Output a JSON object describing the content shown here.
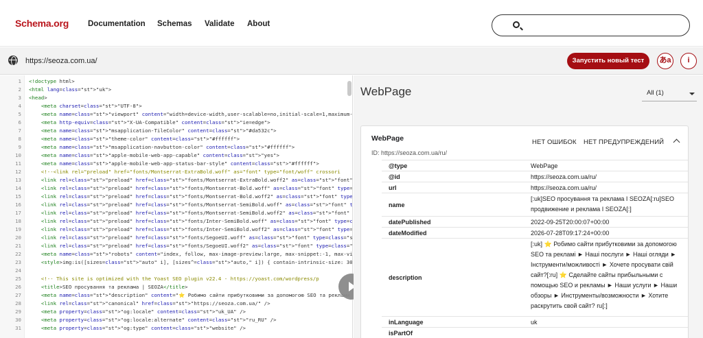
{
  "nav": {
    "logo": "Schema.org",
    "links": [
      "Documentation",
      "Schemas",
      "Validate",
      "About"
    ]
  },
  "urlbar": {
    "url": "https://seoza.com.ua/",
    "run_label": "Запустить новый тест",
    "lang_label": "あa",
    "info_label": "i"
  },
  "code_lines": [
    {
      "n": "1",
      "t": "<!doctype html>"
    },
    {
      "n": "2",
      "t": "<html lang=\"uk\">"
    },
    {
      "n": "3",
      "t": "<head>"
    },
    {
      "n": "4",
      "t": "    <meta charset=\"UTF-8\">"
    },
    {
      "n": "5",
      "t": "    <meta name=\"viewport\" content=\"width=device-width,user-scalable=no,initial-scale=1,maximum-scal"
    },
    {
      "n": "6",
      "t": "    <meta http-equiv=\"X-UA-Compatible\" content=\"ie=edge\">"
    },
    {
      "n": "7",
      "t": "    <meta name=\"msapplication-TileColor\" content=\"#da532c\">"
    },
    {
      "n": "8",
      "t": "    <meta name=\"theme-color\" content=\"#ffffff\">"
    },
    {
      "n": "9",
      "t": "    <meta name=\"msapplication-navbutton-color\" content=\"#ffffff\">"
    },
    {
      "n": "10",
      "t": "    <meta name=\"apple-mobile-web-app-capable\" content=\"yes\">"
    },
    {
      "n": "11",
      "t": "    <meta name=\"apple-mobile-web-app-status-bar-style\" content=\"#ffffff\">"
    },
    {
      "n": "12",
      "t": "    <!--<link rel=\"preload\" href=\"fonts/Montserrat-ExtraBold.woff\" as=\"font\" type=\"font/woff\" crossori"
    },
    {
      "n": "13",
      "t": "    <link rel=\"preload\" href=\"fonts/Montserrat-ExtraBold.woff2\" as=\"font\" type=\"font/woff2\" crossorigi"
    },
    {
      "n": "14",
      "t": "    <link rel=\"preload\" href=\"fonts/Montserrat-Bold.woff\" as=\"font\" type=\"font/woff\" crossorigin=\"a"
    },
    {
      "n": "15",
      "t": "    <link rel=\"preload\" href=\"fonts/Montserrat-Bold.woff2\" as=\"font\" type=\"font/woff2\" crossorigin=\""
    },
    {
      "n": "16",
      "t": "    <link rel=\"preload\" href=\"fonts/Montserrat-SemiBold.woff\" as=\"font\" type=\"font/woff\" crossorigin"
    },
    {
      "n": "17",
      "t": "    <link rel=\"preload\" href=\"fonts/Montserrat-SemiBold.woff2\" as=\"font\" type=\"font/woff2\" crossori"
    },
    {
      "n": "18",
      "t": "    <link rel=\"preload\" href=\"fonts/Inter-SemiBold.woff\" as=\"font\" type=\"font/woff\" crossorigin=\"an"
    },
    {
      "n": "19",
      "t": "    <link rel=\"preload\" href=\"fonts/Inter-SemiBold.woff2\" as=\"font\" type=\"font/woff2\" crossorigin=\""
    },
    {
      "n": "20",
      "t": "    <link rel=\"preload\" href=\"fonts/SegoeUI.woff\" as=\"font\" type=\"font/woff\" crossorigin=\"anonymous"
    },
    {
      "n": "21",
      "t": "    <link rel=\"preload\" href=\"fonts/SegoeUI.woff2\" as=\"font\" type=\"font/woff2\" crossorigin=\"anonym"
    },
    {
      "n": "22",
      "t": "    <meta name=\"robots\" content=\"index, follow, max-image-preview:large, max-snippet:-1, max-video-"
    },
    {
      "n": "23",
      "t": "    <style>img:is([sizes=\"auto\" i], [sizes^=\"auto,\" i]) { contain-intrinsic-size: 3000px 1500px }</"
    },
    {
      "n": "24",
      "t": ""
    },
    {
      "n": "25",
      "t": "    <!-- This site is optimized with the Yoast SEO plugin v22.4 - https://yoast.com/wordpress/p"
    },
    {
      "n": "26",
      "t": "    <title>SEO просування та реклама | SEOZA</title>"
    },
    {
      "n": "27",
      "t": "    <meta name=\"description\" content=\"⭐ Робимо сайти прибутковими за допомогою SEO та реклами ► Н"
    },
    {
      "n": "28",
      "t": "    <link rel=\"canonical\" href=\"https://seoza.com.ua/\" />"
    },
    {
      "n": "29",
      "t": "    <meta property=\"og:locale\" content=\"uk_UA\" />"
    },
    {
      "n": "30",
      "t": "    <meta property=\"og:locale:alternate\" content=\"ru_RU\" />"
    },
    {
      "n": "31",
      "t": "    <meta property=\"og:type\" content=\"website\" />"
    }
  ],
  "result": {
    "title": "WebPage",
    "filter_label": "All (1)",
    "card_title": "WebPage",
    "no_errors": "НЕТ ОШИБОК",
    "no_warnings": "НЕТ ПРЕДУПРЕЖДЕНИЙ",
    "card_id": "ID: https://seoza.com.ua/ru/",
    "properties": [
      {
        "key": "@type",
        "value": "WebPage"
      },
      {
        "key": "@id",
        "value": "https://seoza.com.ua/ru/"
      },
      {
        "key": "url",
        "value": "https://seoza.com.ua/ru/"
      },
      {
        "key": "name",
        "value": "[:uk]SEO просування та реклама I SEOZA[:ru]SEO продвижение и реклама I SEOZA[:]"
      },
      {
        "key": "datePublished",
        "value": "2022-09-25T20:00:07+00:00"
      },
      {
        "key": "dateModified",
        "value": "2026-07-28T09:17:24+00:00"
      },
      {
        "key": "description",
        "value": "[:uk] ⭐ Робимо сайти прибутковими за допомогою SEO та рекламі ► Наші послуги ► Наші огляди ► Інструменти/можливості ► Хочете просувати свій сайт?[:ru] ⭐ Сделайте сайты прибыльными с помощью SEO и рекламы ► Наши услуги ► Наши обзоры ► Инструменты/возможности ► Хотите раскрутить свой сайт? ru[:]"
      },
      {
        "key": "inLanguage",
        "value": "uk"
      },
      {
        "key": "isPartOf",
        "value": ""
      }
    ]
  }
}
